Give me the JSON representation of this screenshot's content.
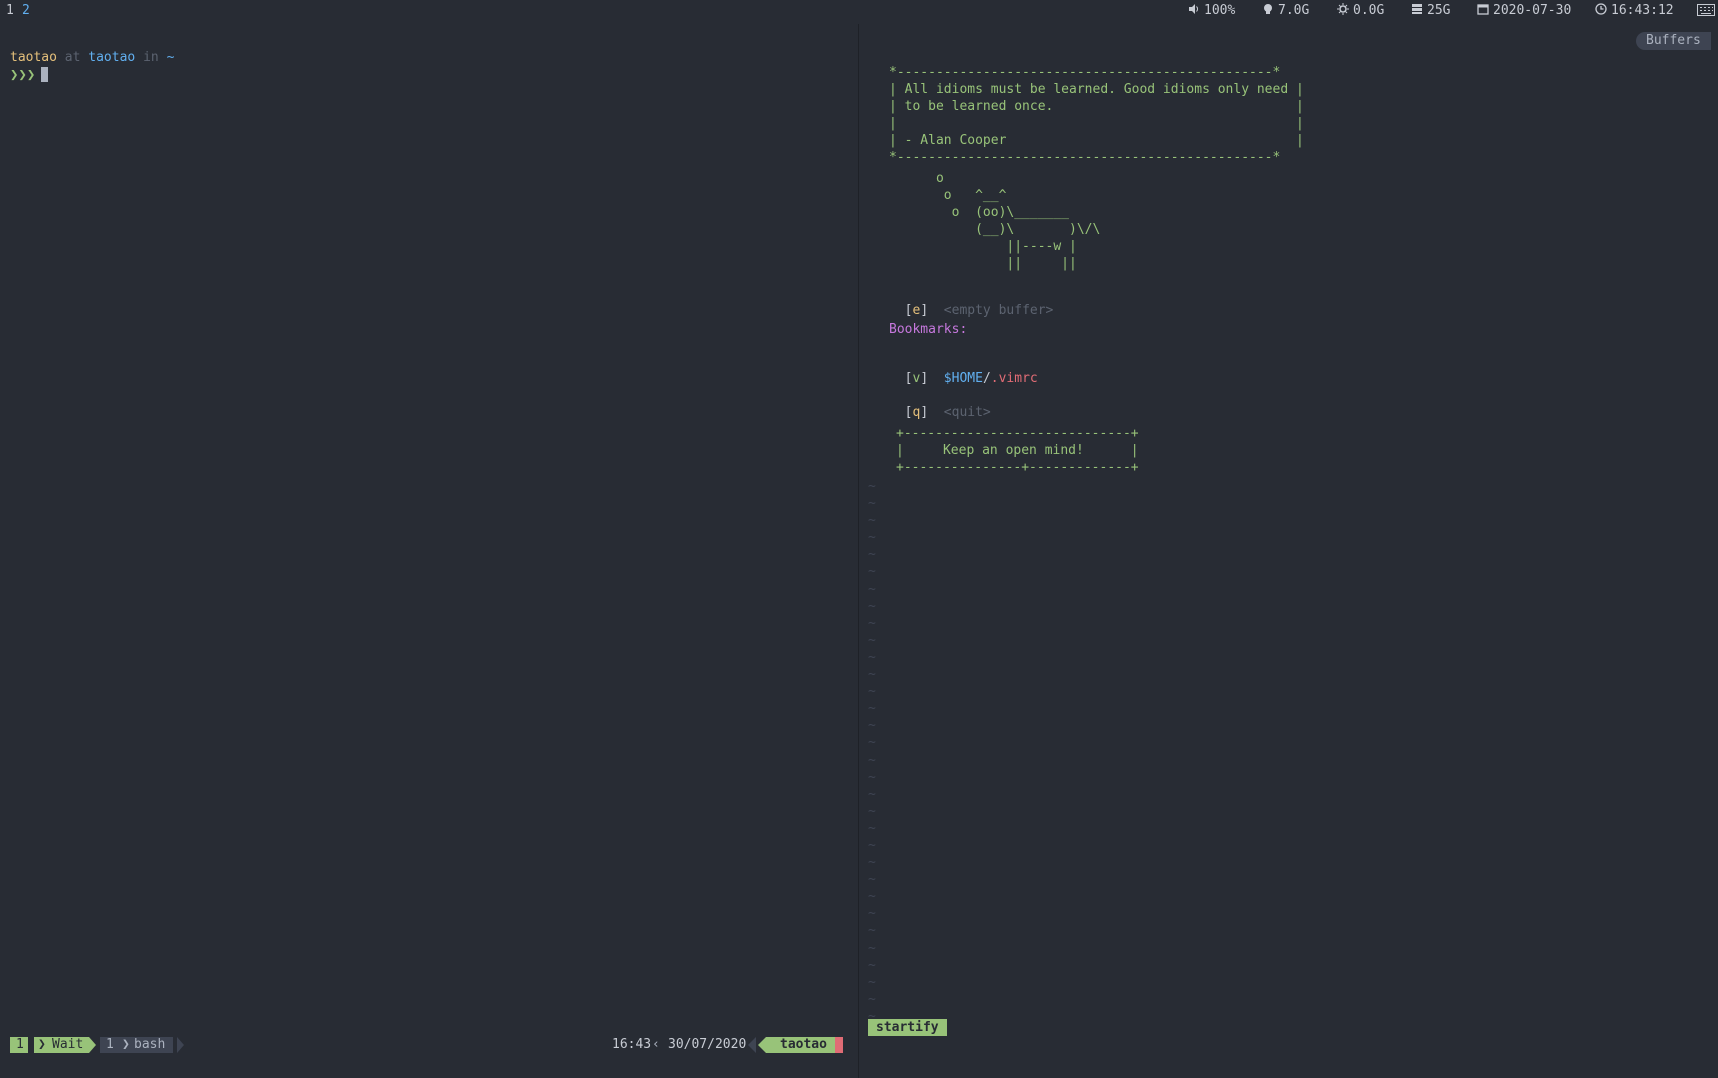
{
  "topbar": {
    "workspaces": [
      "1",
      "2"
    ],
    "volume": "100%",
    "memory": "7.0G",
    "swap": "0.0G",
    "disk": "25G",
    "date": "2020-07-30",
    "time": "16:43:12",
    "icons": [
      "volume-icon",
      "memory-icon",
      "cpu-icon",
      "disk-icon",
      "calendar-icon",
      "clock-icon",
      "keyboard-icon"
    ]
  },
  "terminal": {
    "user": "taotao",
    "at": "at",
    "host": "taotao",
    "in": "in",
    "dir": "~",
    "prompt_symbol": "❯❯❯"
  },
  "tmux": {
    "session_index": "1",
    "session_name": "Wait",
    "window_index": "1",
    "window_name": "bash",
    "time": "16:43",
    "date": "30/07/2020",
    "host": "taotao"
  },
  "vim": {
    "buffers_tab": "Buffers",
    "quote_box": "*------------------------------------------------*\n| All idioms must be learned. Good idioms only need |\n| to be learned once.                               |\n|                                                   |\n| - Alan Cooper                                     |\n*------------------------------------------------*",
    "cow": "      o\n       o   ^__^\n        o  (oo)\\_______\n           (__)\\       )\\/\\\n               ||----w |\n               ||     ||",
    "empty_buffer": {
      "key": "e",
      "label": "<empty buffer>"
    },
    "bookmarks_header": "Bookmarks:",
    "bookmark": {
      "key": "v",
      "path_var": "$HOME",
      "slash": "/",
      "file": ".vimrc"
    },
    "quit": {
      "key": "q",
      "label": "<quit>"
    },
    "footer_box": "+-----------------------------+\n|     Keep an open mind!      |\n+---------------+-------------+",
    "filetype": "startify",
    "tilde": "~"
  },
  "colors": {
    "background": "#282c34",
    "green": "#98c379",
    "blue": "#61afef",
    "red": "#e06c75",
    "yellow": "#e5c07b",
    "purple": "#c678dd"
  }
}
